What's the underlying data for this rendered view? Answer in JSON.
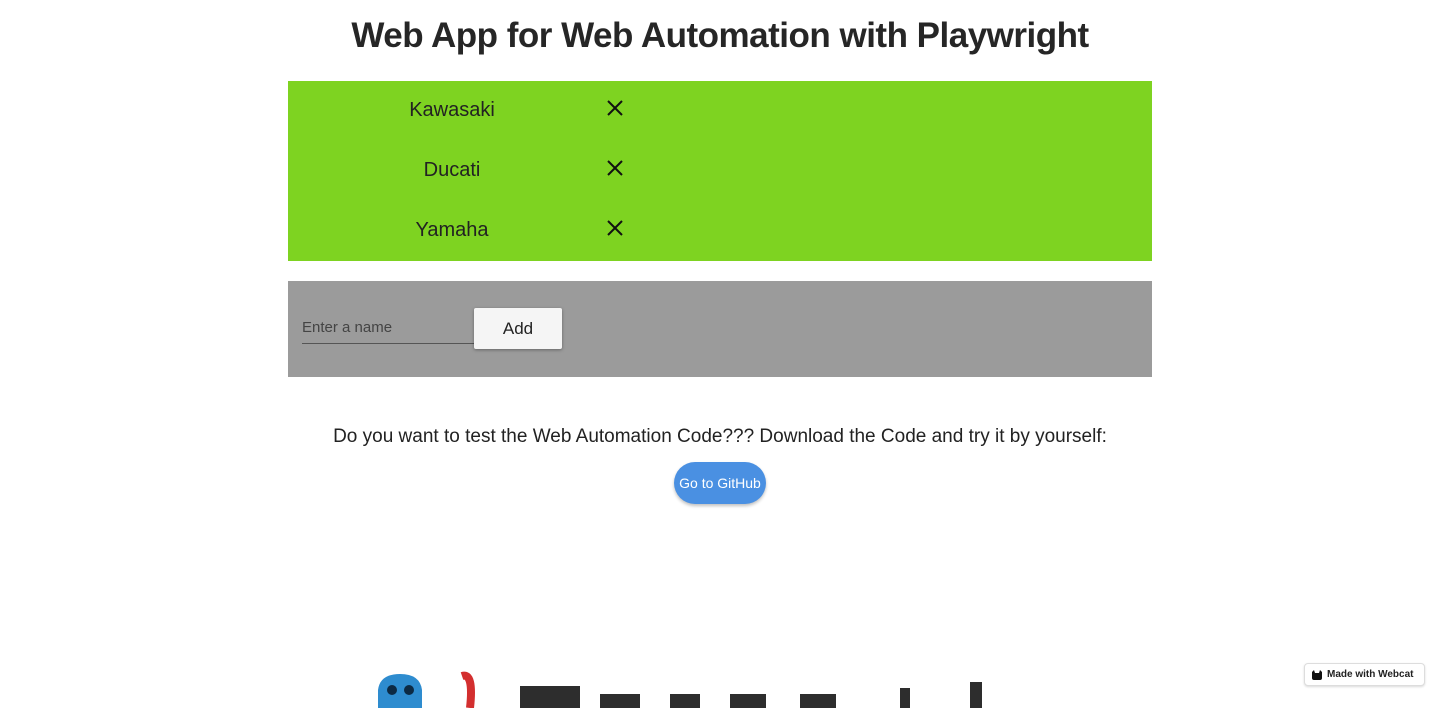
{
  "header": {
    "title": "Web App for Web Automation with Playwright"
  },
  "list": {
    "background": "#7ed321",
    "items": [
      {
        "name": "Kawasaki",
        "remove_icon": "close-icon"
      },
      {
        "name": "Ducati",
        "remove_icon": "close-icon"
      },
      {
        "name": "Yamaha",
        "remove_icon": "close-icon"
      }
    ]
  },
  "form": {
    "background": "#9b9b9b",
    "input_placeholder": "Enter a name",
    "input_value": "",
    "add_label": "Add"
  },
  "cta": {
    "text": "Do you want to test the Web Automation Code??? Download the Code and try it by yourself:",
    "button_label": "Go to GitHub",
    "button_color": "#4a90e2"
  },
  "footer": {
    "logo_icon": "playwright-logo",
    "badge_label": "Made with Webcat",
    "badge_icon": "webcat-icon"
  }
}
